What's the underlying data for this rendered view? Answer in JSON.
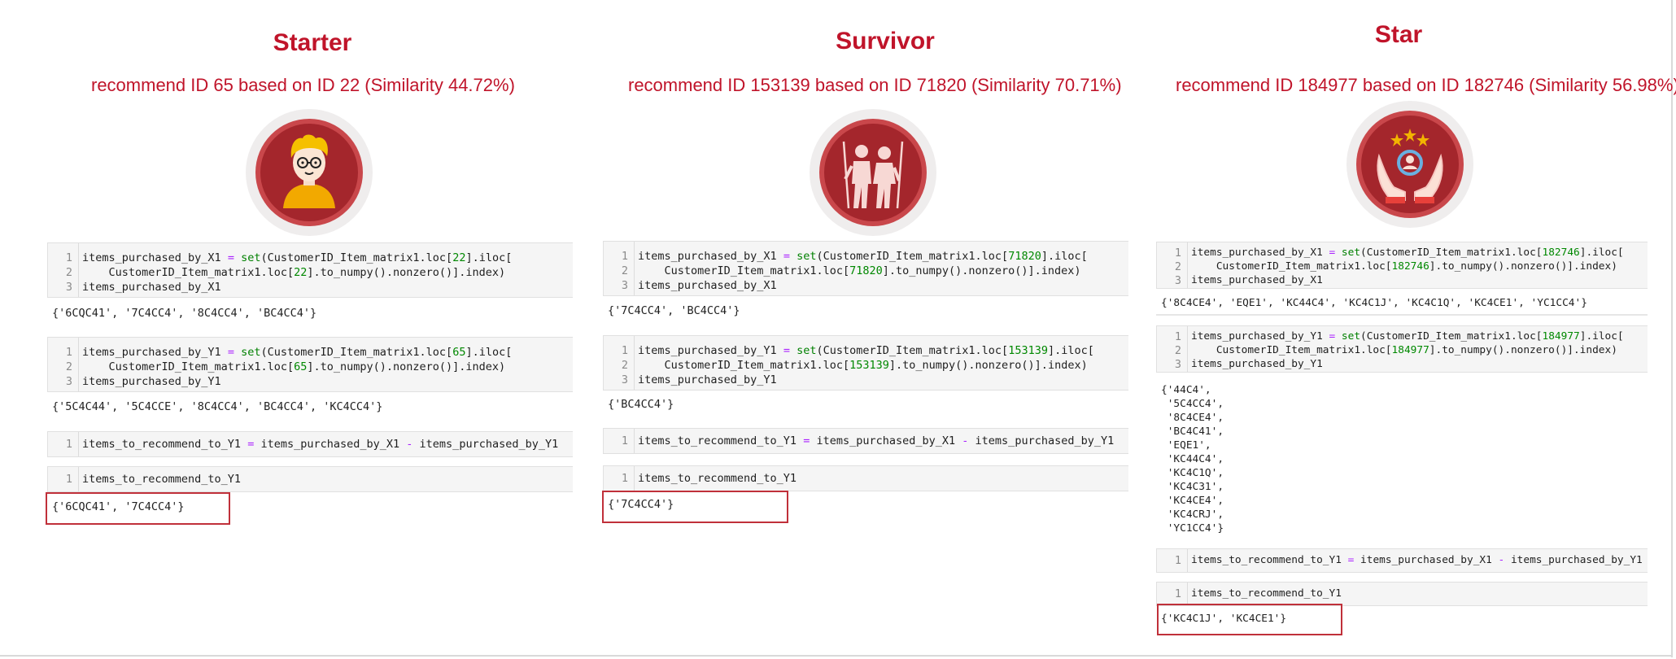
{
  "columns": [
    {
      "title": "Starter",
      "subtitle": "recommend ID 65 based on ID 22 (Similarity 44.72%)",
      "icon": "person-with-glasses-icon",
      "x1_id": "22",
      "y1_id": "65",
      "x1_output": "{'6CQC41', '7C4CC4', '8C4CC4', 'BC4CC4'}",
      "y1_output": "{'5C4C44', '5C4CCE', '8C4CC4', 'BC4CC4', 'KC4CC4'}",
      "recommend_output": "{'6CQC41', '7C4CC4'}"
    },
    {
      "title": "Survivor",
      "subtitle": "recommend ID 153139 based on ID 71820  (Similarity 70.71%)",
      "icon": "hikers-with-poles-icon",
      "x1_id": "71820",
      "y1_id": "153139",
      "x1_output": "{'7C4CC4', 'BC4CC4'}",
      "y1_output": "{'BC4CC4'}",
      "recommend_output": "{'7C4CC4'}"
    },
    {
      "title": "Star",
      "subtitle": "recommend ID 184977 based on ID 182746  (Similarity 56.98%)",
      "icon": "hands-holding-person-with-stars-icon",
      "x1_id": "182746",
      "y1_id": "184977",
      "x1_output": "{'8C4CE4', 'EQE1', 'KC44C4', 'KC4C1J', 'KC4C1Q', 'KC4CE1', 'YC1CC4'}",
      "y1_output_lines": [
        "{'44C4',",
        " '5C4CC4',",
        " '8C4CE4',",
        " 'BC4C41',",
        " 'EQE1',",
        " 'KC44C4',",
        " 'KC4C1Q',",
        " 'KC4C31',",
        " 'KC4CE4',",
        " 'KC4CRJ',",
        " 'YC1CC4'}"
      ],
      "recommend_output": "{'KC4C1J', 'KC4CE1'}"
    }
  ],
  "code": {
    "var_x1": "items_purchased_by_X1",
    "var_y1": "items_purchased_by_Y1",
    "set_fn": "set",
    "matrix_loc": "CustomerID_Item_matrix1.loc[",
    "iloc_tail": "].iloc[",
    "to_numpy_tail": "].to_numpy().nonzero()].index)",
    "line2_indent": "    CustomerID_Item_matrix1.loc[",
    "assign_op": " = ",
    "open_paren": "(",
    "recommend_var": "items_to_recommend_to_Y1",
    "minus_op": " - ",
    "line_numbers": [
      "1",
      "2",
      "3"
    ]
  }
}
